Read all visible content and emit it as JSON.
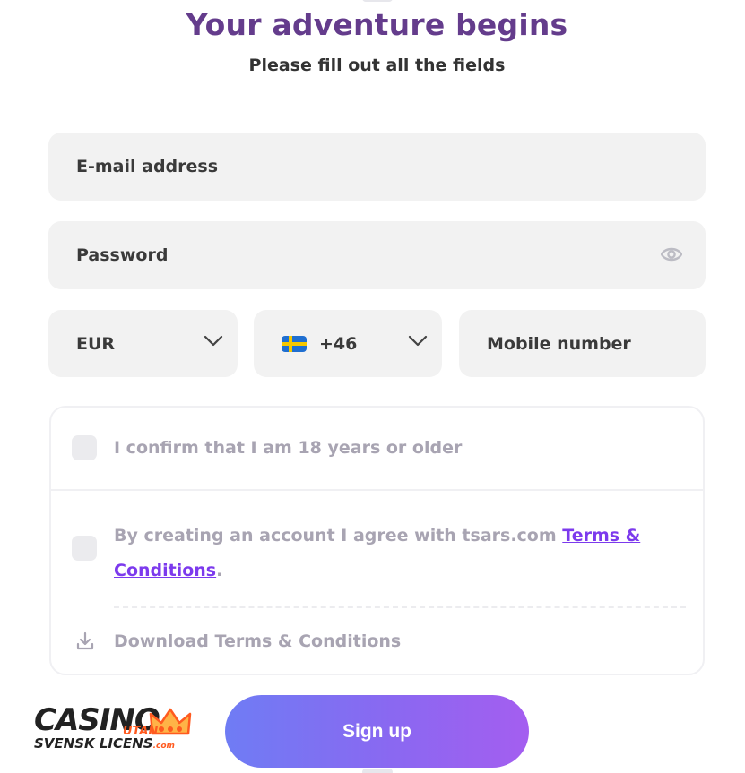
{
  "header": {
    "title": "Your adventure begins",
    "subtitle": "Please fill out all the fields"
  },
  "form": {
    "email_placeholder": "E-mail address",
    "password_placeholder": "Password",
    "currency_value": "EUR",
    "phone_code_value": "+46",
    "mobile_placeholder": "Mobile number"
  },
  "terms": {
    "age_confirm": "I confirm that I am 18 years or older",
    "agree_prefix": "By creating an account I agree with tsars.com ",
    "agree_link": "Terms & Conditions",
    "agree_suffix": ".",
    "download_label": "Download Terms & Conditions"
  },
  "logo": {
    "line1": "CASINO",
    "utan": "UTAN",
    "line2": "SVENSK LICENS",
    "com": ".com"
  },
  "actions": {
    "signup_label": "Sign up"
  },
  "colors": {
    "title": "#643c8c",
    "link": "#7c3aed",
    "field_bg": "#f2f2f2",
    "button_gradient_start": "#6f7cf4",
    "button_gradient_end": "#a45ef0"
  },
  "icons": [
    "eye-icon",
    "chevron-down-icon",
    "sweden-flag-icon",
    "download-icon",
    "crown-icon"
  ]
}
